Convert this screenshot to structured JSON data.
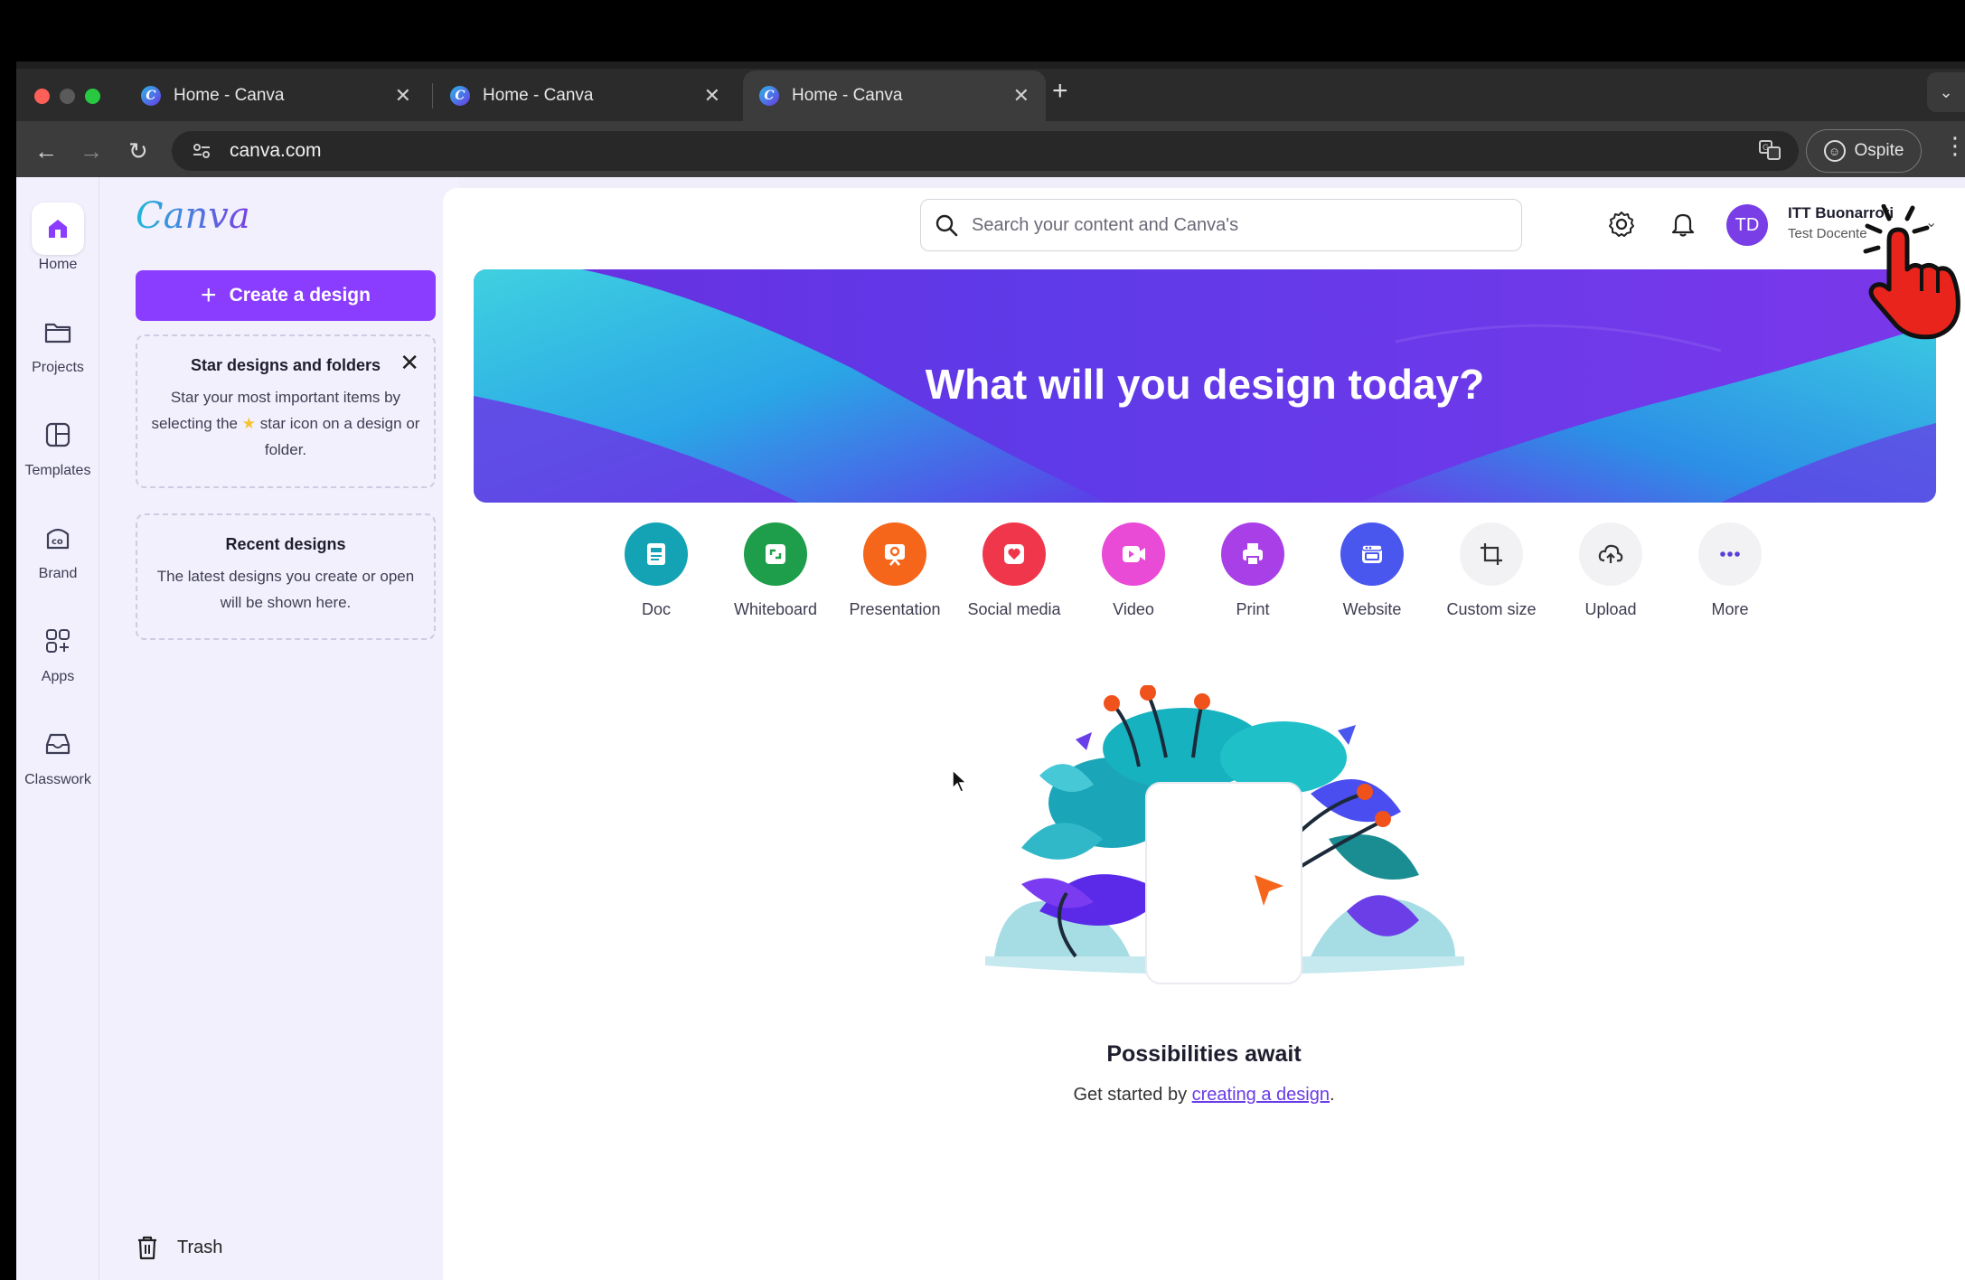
{
  "browser": {
    "tabs": [
      {
        "title": "Home - Canva",
        "close": "✕"
      },
      {
        "title": "Home - Canva",
        "close": "✕"
      },
      {
        "title": "Home - Canva",
        "close": "✕"
      }
    ],
    "new_tab": "+",
    "url": "canva.com",
    "guest_label": "Ospite"
  },
  "rail": {
    "items": [
      {
        "label": "Home",
        "icon": "home-icon"
      },
      {
        "label": "Projects",
        "icon": "folder-icon"
      },
      {
        "label": "Templates",
        "icon": "templates-icon"
      },
      {
        "label": "Brand",
        "icon": "brand-icon"
      },
      {
        "label": "Apps",
        "icon": "apps-icon"
      },
      {
        "label": "Classwork",
        "icon": "inbox-icon"
      }
    ]
  },
  "sidepanel": {
    "logo": "Canva",
    "create_label": "Create a design",
    "star_card": {
      "title": "Star designs and folders",
      "body_before": "Star your most important items by selecting the",
      "body_after": "star icon on a design or folder."
    },
    "recent_card": {
      "title": "Recent designs",
      "body": "The latest designs you create or open will be shown here."
    },
    "trash_label": "Trash"
  },
  "header": {
    "search_placeholder": "Search your content and Canva's",
    "avatar_initials": "TD",
    "account_name": "ITT Buonarroti",
    "account_role": "Test Docente"
  },
  "hero": {
    "title": "What will you design today?"
  },
  "shortcuts": [
    {
      "label": "Doc",
      "color": "#13a3b5",
      "icon": "doc-icon"
    },
    {
      "label": "Whiteboard",
      "color": "#1e9e4a",
      "icon": "whiteboard-icon"
    },
    {
      "label": "Presentation",
      "color": "#f5661b",
      "icon": "presentation-icon"
    },
    {
      "label": "Social media",
      "color": "#f0364a",
      "icon": "social-media-icon"
    },
    {
      "label": "Video",
      "color": "#e94ad6",
      "icon": "video-icon"
    },
    {
      "label": "Print",
      "color": "#a93fe6",
      "icon": "print-icon"
    },
    {
      "label": "Website",
      "color": "#4a57ee",
      "icon": "website-icon"
    },
    {
      "label": "Custom size",
      "color": "#f2f2f5",
      "icon": "custom-size-icon"
    },
    {
      "label": "Upload",
      "color": "#f2f2f5",
      "icon": "upload-icon"
    },
    {
      "label": "More",
      "color": "#f2f2f5",
      "icon": "more-icon"
    }
  ],
  "empty_state": {
    "title": "Possibilities await",
    "subtitle_before": "Get started by",
    "link": "creating a design",
    "subtitle_after": "."
  },
  "colors": {
    "accent": "#8b3dff",
    "sidebar_bg": "#f2f0fc"
  }
}
